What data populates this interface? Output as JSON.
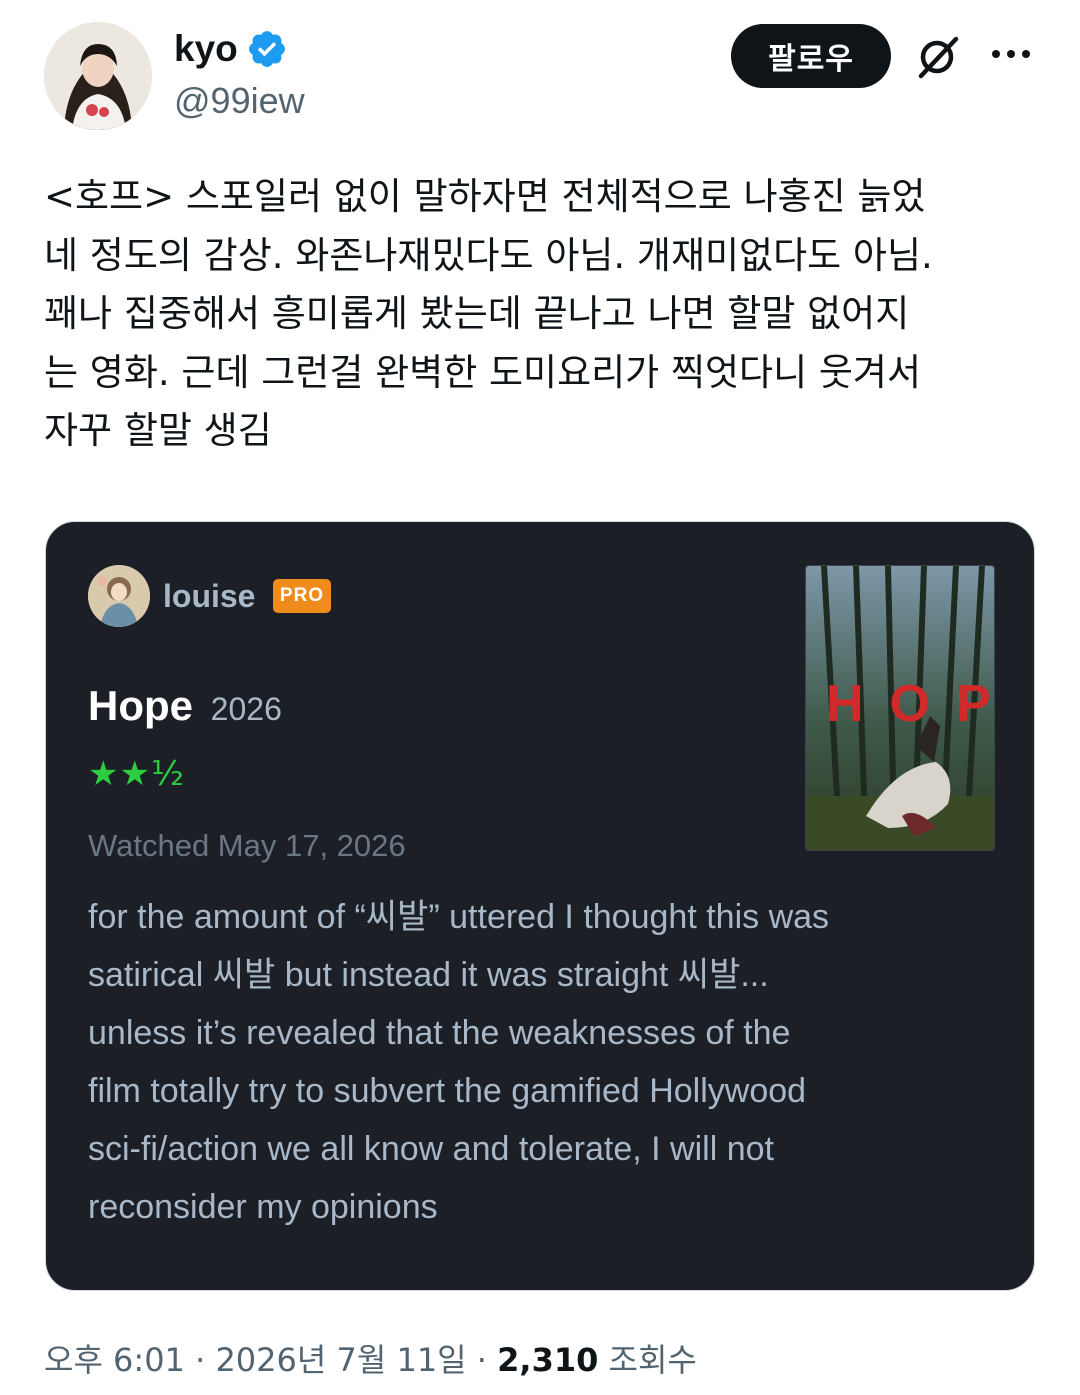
{
  "author": {
    "name": "kyo",
    "handle": "@99iew",
    "verified": true
  },
  "header": {
    "follow_label": "팔로우",
    "icons": [
      "grok-icon",
      "more-icon"
    ]
  },
  "tweet": {
    "text": "<호프> 스포일러 없이 말하자면 전체적으로 나홍진 늙었\n네 정도의 감상. 와존나재밌다도 아님. 개재미없다도 아님.\n꽤나 집중해서 흥미롭게 봤는데 끝나고 나면 할말 없어지\n는 영화. 근데 그런걸 완벽한 도미요리가 찍엇다니 웃겨서\n자꾸 할말 생김"
  },
  "review_card": {
    "reviewer": "louise",
    "badge": "PRO",
    "film_title": "Hope",
    "film_year": "2026",
    "rating_text": "★★½",
    "rating_value": 2.5,
    "watched": "Watched May 17, 2026",
    "poster_title": "HOPE",
    "body": "for the amount of “씨발” uttered I thought this was\nsatirical 씨발 but instead it was straight 씨발...\nunless it’s revealed that the weaknesses of the\nfilm totally try to subvert the gamified Hollywood\nsci-fi/action we all know and tolerate, I will not\nreconsider my opinions"
  },
  "meta": {
    "time": "오후 6:01",
    "separator": " · ",
    "date": "2026년 7월 11일",
    "views_count": "2,310",
    "views_label": "조회수"
  },
  "colors": {
    "card_bg": "#1c2026",
    "star_green": "#2ecc40",
    "pro_orange": "#f08c1d",
    "verified_blue": "#1d9bf0"
  }
}
